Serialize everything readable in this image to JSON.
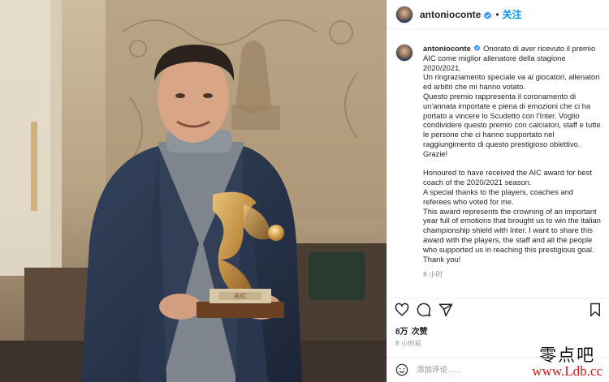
{
  "header": {
    "username": "antonioconte",
    "separator": "•",
    "follow_label": "关注"
  },
  "caption": {
    "username": "antonioconte",
    "italian": [
      "Onorato di aver ricevuto il premio AIC come miglior allenatore della stagione 2020/2021.",
      "Un ringraziamento speciale va ai giocatori, allenatori ed arbitri che mi hanno votato.",
      "Questo premio rappresenta il coronamento di un'annata importate e piena di emozioni che ci ha portato a vincere lo Scudetto con l'Inter. Voglio condividere questo premio con calciatori, staff e tutte le persone che ci hanno supportato nel raggiungimento di questo prestigioso obiettivo.",
      "Grazie!"
    ],
    "english": [
      "Honoured to have received the AIC award for best coach of the 2020/2021 season.",
      "A special thanks to the players, coaches and referees who voted for me.",
      "This award represents the crowning of an important year full of emotions that brought us to win the italian championship shield with Inter. I want to share this award with the players, the staff and all the people who supported us in reaching this prestigious goal. Thank you!"
    ],
    "time_ago": "8 小时"
  },
  "actions": {
    "icons": [
      "heart-icon",
      "comment-icon",
      "share-icon",
      "bookmark-icon"
    ]
  },
  "likes": {
    "count": "8万",
    "label": "次赞"
  },
  "post_time": "8 小时前",
  "comment": {
    "placeholder": "添加评论......"
  },
  "photo": {
    "trophy_plaque_text": "AIC"
  },
  "watermark": {
    "site_name": "零点吧",
    "url": "www.Ldb.cc"
  },
  "colors": {
    "accent": "#0095f6",
    "verified": "#3897f0",
    "text": "#262626",
    "muted": "#8e8e8e",
    "watermark_url": "#d21a1a"
  }
}
